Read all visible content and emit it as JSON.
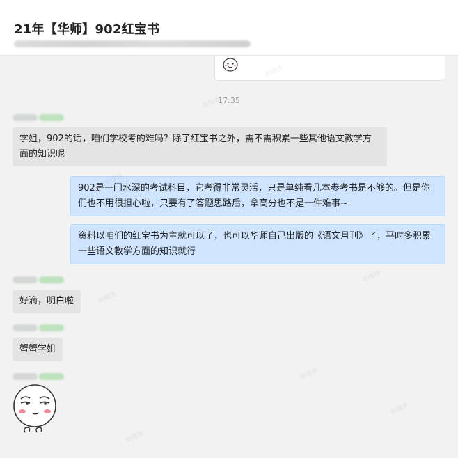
{
  "header": {
    "title": "21年【华师】902红宝书"
  },
  "timestamp": "17:35",
  "messages": [
    {
      "side": "left",
      "text": "学姐，902的话，咱们学校考的难吗？除了红宝书之外，需不需积累一些其他语文教学方面的知识呢"
    },
    {
      "side": "right",
      "text": "902是一门水深的考试科目，它考得非常灵活，只是单纯看几本参考书是不够的。但是你们也不用很担心啦，只要有了答题思路后，拿高分也不是一件难事~"
    },
    {
      "side": "right",
      "text": "资料以咱们的红宝书为主就可以了，也可以华师自己出版的《语文月刊》了，平时多积累一些语文教学方面的知识就行"
    },
    {
      "side": "left",
      "text": "好滴，明白啦"
    },
    {
      "side": "left",
      "text": "蟹蟹学姐"
    }
  ],
  "icons": {
    "previous_sticker": "smiley-face-icon",
    "sticker": "smug-face-sticker-icon"
  },
  "colors": {
    "outgoing_bubble": "#cfe5ff",
    "incoming_bubble": "#e4e4e4",
    "background": "#f2f2f2"
  }
}
